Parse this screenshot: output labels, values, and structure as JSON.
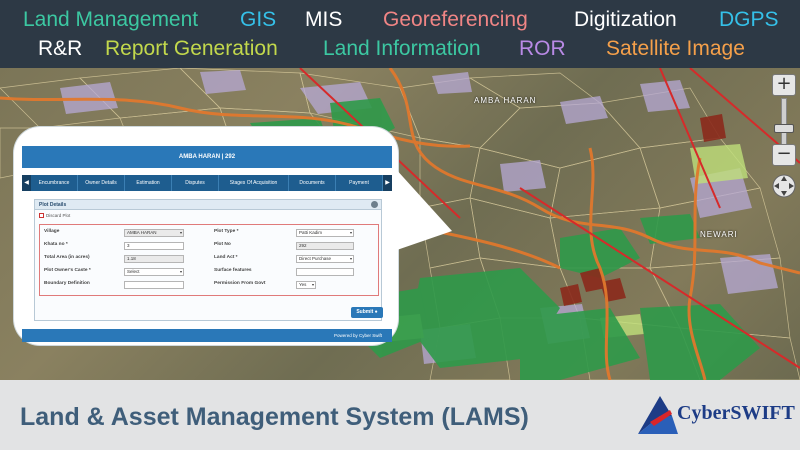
{
  "banner": {
    "keywords": [
      {
        "label": "Land Management",
        "color": "#3cc8a2"
      },
      {
        "label": "GIS",
        "color": "#35c0e8"
      },
      {
        "label": "MIS",
        "color": "#ffffff"
      },
      {
        "label": "Georeferencing",
        "color": "#f08585"
      },
      {
        "label": "Digitization",
        "color": "#ffffff"
      },
      {
        "label": "DGPS",
        "color": "#35c0e8"
      },
      {
        "label": "R&R",
        "color": "#ffffff"
      },
      {
        "label": "Report Generation",
        "color": "#c2d84c"
      },
      {
        "label": "Land Information",
        "color": "#3cc8a2"
      },
      {
        "label": "ROR",
        "color": "#b98ae6"
      },
      {
        "label": "Satellite Image",
        "color": "#f5a04a"
      }
    ]
  },
  "map": {
    "labels": [
      "AMBA HARAN",
      "NEWARI"
    ],
    "controls": {
      "zoom_in": "+",
      "zoom_out": "−"
    }
  },
  "app": {
    "title": "AMBA HARAN | 292",
    "tabs": [
      "Encumbrance",
      "Owner Details",
      "Estimation",
      "Disputes",
      "Stages Of Acquisition",
      "Documents",
      "Payment"
    ],
    "panel_title": "Plot Details",
    "discard_label": "Discard Plot",
    "fields_left": [
      {
        "label": "Village",
        "value": "AMBA HARAN",
        "kind": "select-disabled"
      },
      {
        "label": "Khata no *",
        "value": "3",
        "kind": "text"
      },
      {
        "label": "Total Area (in acres)",
        "value": "1.18",
        "kind": "disabled"
      },
      {
        "label": "Plot Owner's Caste *",
        "value": "Select",
        "kind": "select"
      },
      {
        "label": "Boundary Definition",
        "value": "",
        "kind": "text"
      }
    ],
    "fields_right": [
      {
        "label": "Plot Type *",
        "value": "Patti Kadim",
        "kind": "select"
      },
      {
        "label": "Plot No",
        "value": "292",
        "kind": "disabled"
      },
      {
        "label": "Land Act *",
        "value": "Direct Purchase",
        "kind": "select"
      },
      {
        "label": "Surface features",
        "value": "",
        "kind": "text"
      },
      {
        "label": "Permission From Govt",
        "value": "Yes",
        "kind": "select"
      }
    ],
    "submit_label": "Submit",
    "footer": "Powered by Cyber Swift"
  },
  "footer_bar": {
    "title": "Land & Asset Management System (LAMS)",
    "brand": "CyberSWIFT"
  },
  "colors": {
    "banner_bg": "#2d3945",
    "app_blue": "#2a78b8",
    "title_text": "#3f5e7a",
    "brand": "#1d3c86",
    "forest": "#2f9a4a",
    "road": "#e0782d",
    "boundary": "#d62a2a"
  }
}
